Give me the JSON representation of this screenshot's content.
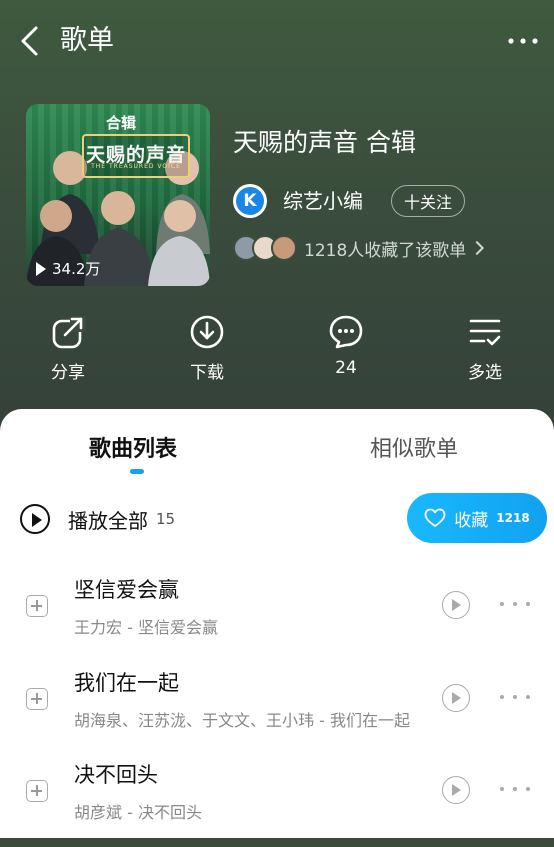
{
  "header": {
    "title": "歌单"
  },
  "playlist": {
    "cover_badge": "合辑",
    "cover_logo_text": "天赐的声音",
    "cover_logo_sub": "THE TREASURED VOICE",
    "play_count": "34.2万",
    "title": "天赐的声音 合辑",
    "creator_initial": "K",
    "creator_name": "综艺小编",
    "follow_label": "十关注",
    "collectors_text": "1218人收藏了该歌单",
    "accent_color": "#1aa0f0"
  },
  "actions": [
    {
      "label": "分享",
      "icon": "share-icon"
    },
    {
      "label": "下载",
      "icon": "download-icon"
    },
    {
      "label": "24",
      "icon": "comment-icon"
    },
    {
      "label": "多选",
      "icon": "multi-select-icon"
    }
  ],
  "tabs": [
    {
      "label": "歌曲列表",
      "active": true
    },
    {
      "label": "相似歌单",
      "active": false
    }
  ],
  "play_all": {
    "label": "播放全部",
    "count": "15"
  },
  "collect": {
    "label": "收藏",
    "count": "1218"
  },
  "songs": [
    {
      "title": "坚信爱会赢",
      "subtitle": "王力宏 - 坚信爱会赢"
    },
    {
      "title": "我们在一起",
      "subtitle": "胡海泉、汪苏泷、于文文、王小玮 - 我们在一起"
    },
    {
      "title": "决不回头",
      "subtitle": "胡彦斌 - 决不回头"
    }
  ]
}
